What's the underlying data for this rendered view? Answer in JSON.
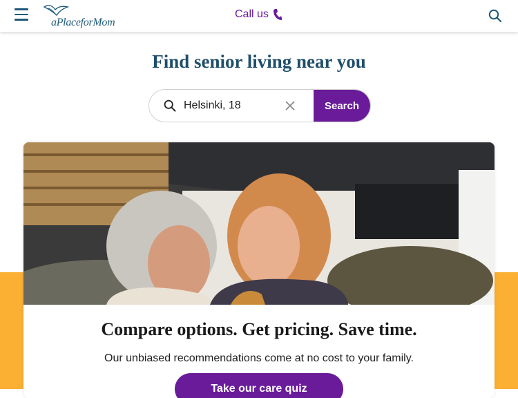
{
  "header": {
    "brand": "aPlaceforMom",
    "call_label": "Call us",
    "icons": [
      "hamburger-menu-icon",
      "bird-logo-icon",
      "phone-icon",
      "search-icon"
    ]
  },
  "hero": {
    "headline": "Find senior living near you",
    "search_value": "Helsinki, 18",
    "search_button": "Search"
  },
  "card": {
    "title": "Compare options. Get pricing. Save time.",
    "subtitle": "Our unbiased recommendations come at no cost to your family.",
    "cta_label": "Take our care quiz"
  },
  "colors": {
    "brand_blue": "#1f5a7a",
    "purple": "#6a1b9a",
    "yellow": "#fbb034"
  }
}
